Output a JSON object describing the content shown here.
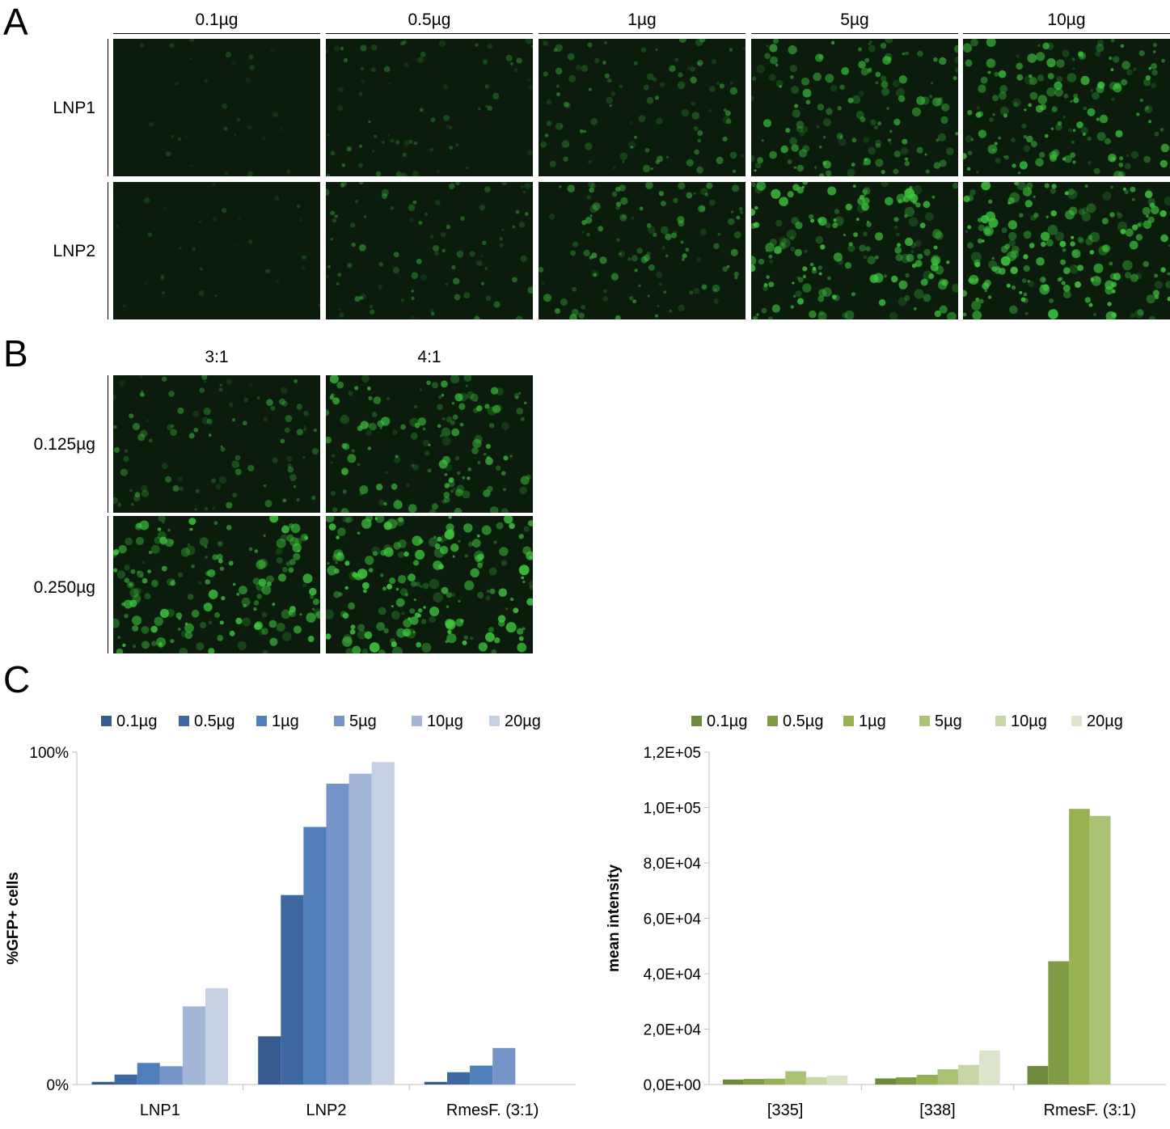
{
  "panels": {
    "a": "A",
    "b": "B",
    "c": "C"
  },
  "panel_a": {
    "columns": [
      "0.1µg",
      "0.5µg",
      "1µg",
      "5µg",
      "10µg"
    ],
    "rows": [
      "LNP1",
      "LNP2"
    ],
    "brightness": [
      [
        0.05,
        0.28,
        0.45,
        0.7,
        0.82
      ],
      [
        0.05,
        0.38,
        0.55,
        0.9,
        1.0
      ]
    ]
  },
  "panel_b": {
    "columns": [
      "3:1",
      "4:1"
    ],
    "rows": [
      "0.125µg",
      "0.250µg"
    ],
    "brightness": [
      [
        0.45,
        0.75
      ],
      [
        0.9,
        1.0
      ]
    ]
  },
  "colors": {
    "blue": [
      "#365b8f",
      "#3f67a1",
      "#4f7ebb",
      "#7594c8",
      "#a4b6d7",
      "#c6d1e6"
    ],
    "green": [
      "#6d8a3d",
      "#7f9b45",
      "#98b253",
      "#a9c274",
      "#c6d6a4",
      "#dce5c9"
    ],
    "micrograph_bg": "#0b1b0c",
    "cell": "#3ec83e"
  },
  "chart_data": [
    {
      "type": "bar",
      "categories": [
        "LNP1",
        "LNP2",
        "RmesF. (3:1)"
      ],
      "series": [
        {
          "name": "0.1µg",
          "values": [
            0.8,
            14.5,
            0.8
          ]
        },
        {
          "name": "0.5µg",
          "values": [
            3,
            57,
            3.7
          ]
        },
        {
          "name": "1µg",
          "values": [
            6.5,
            77.5,
            5.7
          ]
        },
        {
          "name": "5µg",
          "values": [
            5.5,
            90.5,
            11
          ]
        },
        {
          "name": "10µg",
          "values": [
            23.5,
            93.5,
            null
          ]
        },
        {
          "name": "20µg",
          "values": [
            29,
            97,
            null
          ]
        }
      ],
      "xlabel": "",
      "ylabel": "%GFP+ cells",
      "ylim": [
        0,
        100
      ],
      "yticks": [
        "0%",
        "100%"
      ],
      "legend": "top",
      "grid": false
    },
    {
      "type": "bar",
      "categories": [
        "[335]",
        "[338]",
        "RmesF. (3:1)"
      ],
      "series": [
        {
          "name": "0.1µg",
          "values": [
            1800,
            2200,
            6700
          ]
        },
        {
          "name": "0.5µg",
          "values": [
            2000,
            2600,
            44500
          ]
        },
        {
          "name": "1µg",
          "values": [
            2100,
            3500,
            99500
          ]
        },
        {
          "name": "5µg",
          "values": [
            4800,
            5500,
            97000
          ]
        },
        {
          "name": "10µg",
          "values": [
            2700,
            7100,
            null
          ]
        },
        {
          "name": "20µg",
          "values": [
            3200,
            12300,
            null
          ]
        }
      ],
      "xlabel": "",
      "ylabel": "mean intensity",
      "ylim": [
        0,
        120000
      ],
      "yticks": [
        "0,0E+00",
        "2,0E+04",
        "4,0E+04",
        "6,0E+04",
        "8,0E+04",
        "1,0E+05",
        "1,2E+05"
      ],
      "legend": "top",
      "grid": false
    }
  ]
}
